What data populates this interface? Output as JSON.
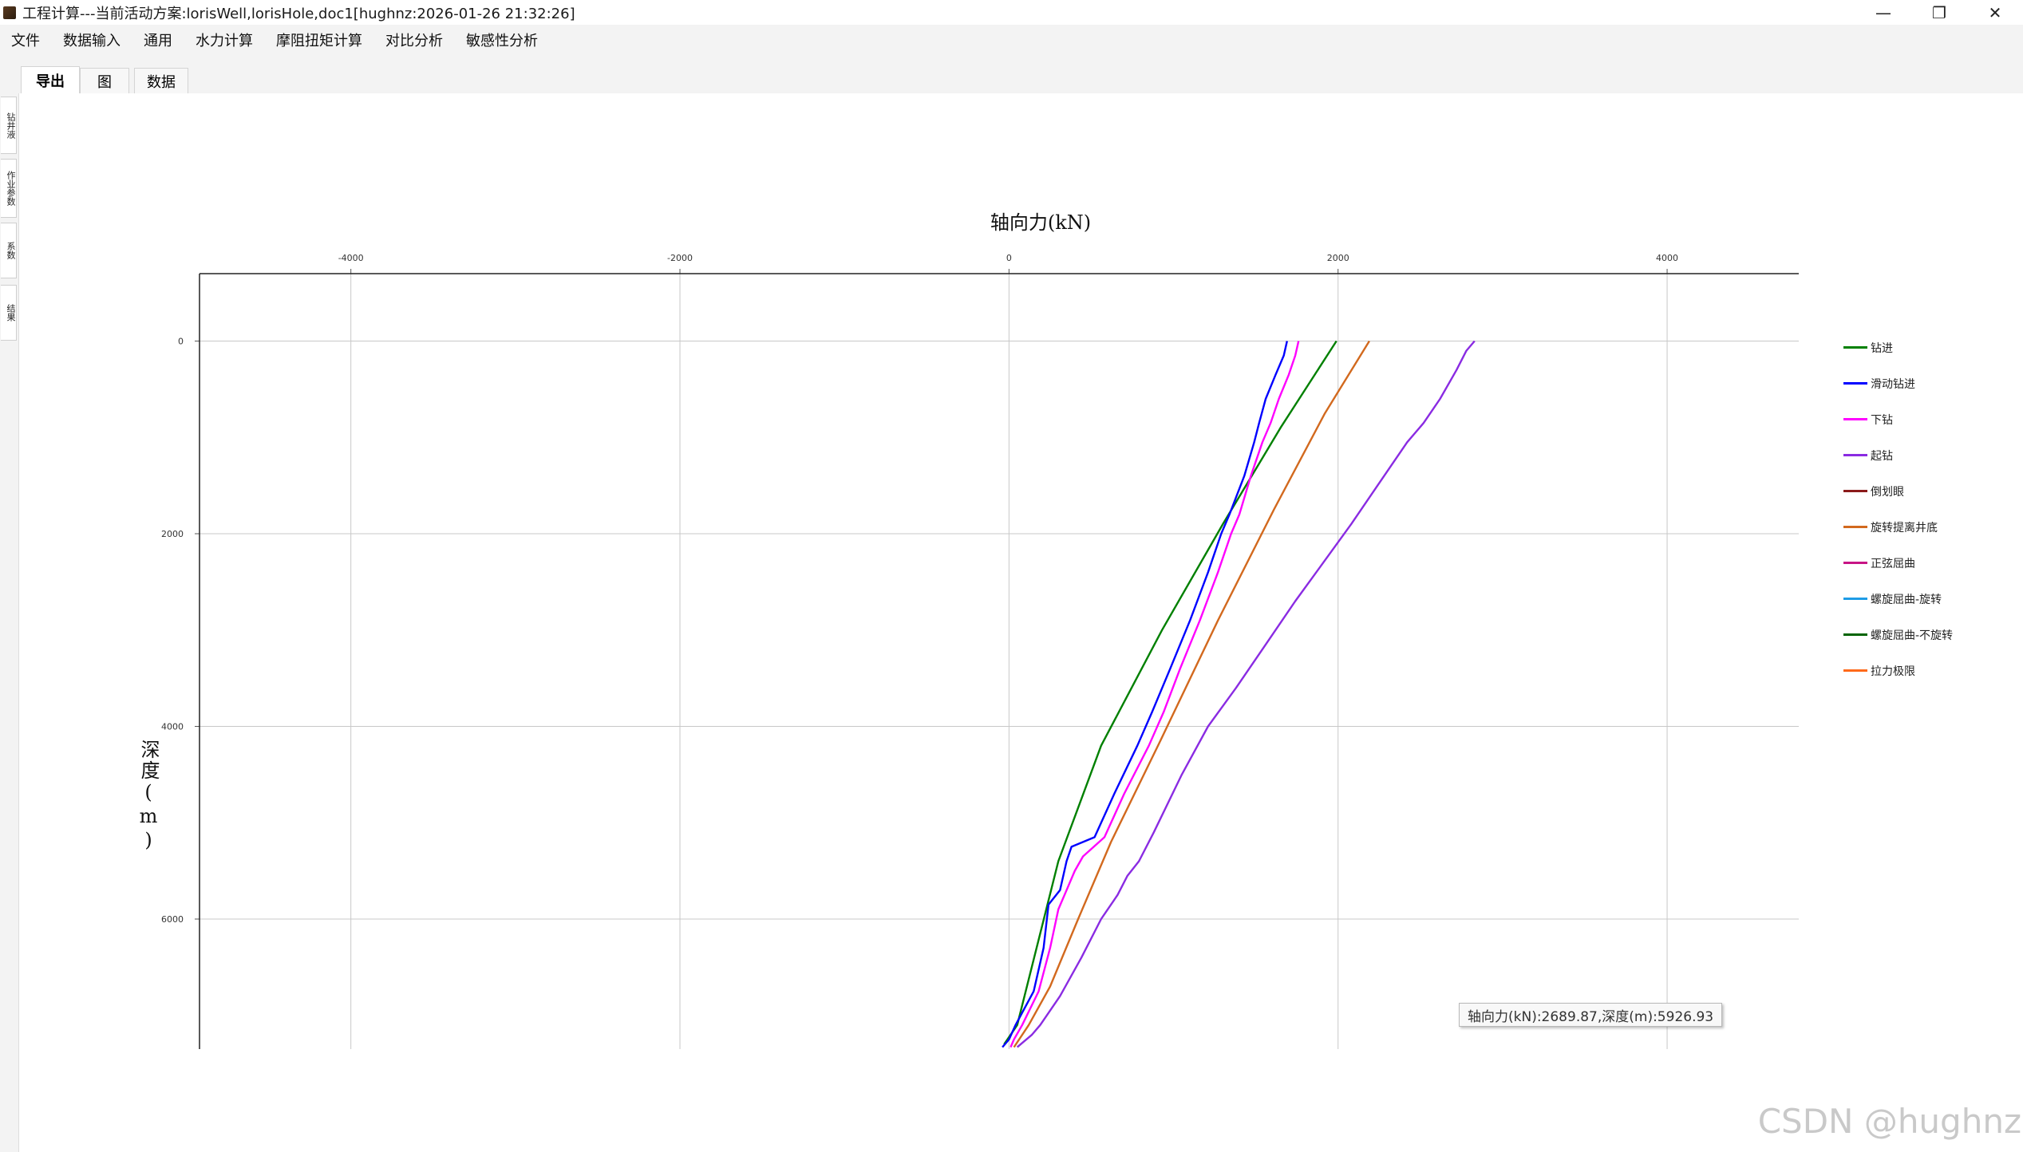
{
  "window": {
    "title": "工程计算---当前活动方案:lorisWell,lorisHole,doc1[hughnz:2026-01-26 21:32:26]",
    "minimize_glyph": "—",
    "maximize_glyph": "❐",
    "close_glyph": "✕"
  },
  "menu": [
    "文件",
    "数据输入",
    "通用",
    "水力计算",
    "摩阻扭矩计算",
    "对比分析",
    "敏感性分析"
  ],
  "tabs": [
    {
      "label": "导出",
      "active": true
    },
    {
      "label": "图",
      "active": false
    },
    {
      "label": "数据",
      "active": false
    }
  ],
  "side_tabs": [
    "钻井液",
    "作业参数",
    "系数",
    "结果"
  ],
  "tooltip": "轴向力(kN):2689.87,深度(m):5926.93",
  "watermark": "CSDN @hughnz",
  "chart_data": {
    "type": "line",
    "title": "轴向力(kN)",
    "xlabel": "轴向力(kN)",
    "ylabel": "深度(m)",
    "x_axis_position": "top",
    "y_axis_inverted": true,
    "xlim": [
      -4920,
      4800
    ],
    "ylim": [
      -700,
      7350
    ],
    "x_ticks": [
      -4000,
      -2000,
      0,
      2000,
      4000
    ],
    "x_tick_labels": [
      "-4000",
      "-2000",
      "0",
      "2000",
      "4000"
    ],
    "y_ticks": [
      0,
      2000,
      4000,
      6000
    ],
    "y_tick_labels": [
      "0",
      "2000",
      "4000",
      "6000"
    ],
    "grid": true,
    "legend_position": "right",
    "series": [
      {
        "name": "钻进",
        "color": "#008000",
        "x": [
          1990,
          1650,
          1300,
          930,
          560,
          300,
          50,
          -30
        ],
        "y": [
          0,
          900,
          1900,
          3000,
          4200,
          5400,
          7100,
          7300
        ]
      },
      {
        "name": "滑动钻进",
        "color": "#0000ff",
        "x": [
          1690,
          1670,
          1620,
          1560,
          1520,
          1490,
          1430,
          1340,
          1290,
          1210,
          1100,
          980,
          870,
          780,
          640,
          520,
          380,
          350,
          310,
          240,
          210,
          150,
          40,
          0,
          -40
        ],
        "y": [
          0,
          150,
          350,
          600,
          850,
          1050,
          1400,
          1800,
          2000,
          2400,
          2900,
          3400,
          3850,
          4200,
          4700,
          5150,
          5250,
          5400,
          5700,
          5850,
          6300,
          6750,
          7100,
          7250,
          7330
        ]
      },
      {
        "name": "下钻",
        "color": "#ff00ff",
        "x": [
          1760,
          1740,
          1700,
          1640,
          1590,
          1540,
          1470,
          1400,
          1350,
          1270,
          1160,
          1040,
          940,
          850,
          700,
          580,
          450,
          400,
          350,
          300,
          250,
          180,
          80,
          30,
          10
        ],
        "y": [
          0,
          150,
          350,
          600,
          850,
          1050,
          1400,
          1800,
          2000,
          2400,
          2900,
          3400,
          3850,
          4200,
          4700,
          5150,
          5350,
          5500,
          5700,
          5900,
          6300,
          6750,
          7100,
          7250,
          7330
        ]
      },
      {
        "name": "起钻",
        "color": "#8a2be2",
        "x": [
          2830,
          2780,
          2720,
          2620,
          2520,
          2420,
          2240,
          2080,
          1910,
          1740,
          1560,
          1380,
          1210,
          1050,
          880,
          790,
          720,
          660,
          560,
          440,
          310,
          190,
          140,
          50
        ],
        "y": [
          0,
          100,
          300,
          600,
          850,
          1050,
          1500,
          1900,
          2300,
          2700,
          3150,
          3600,
          4000,
          4500,
          5100,
          5400,
          5550,
          5750,
          6000,
          6400,
          6800,
          7100,
          7200,
          7330
        ]
      },
      {
        "name": "倒划眼",
        "color": "#8b1a1a",
        "x": [],
        "y": []
      },
      {
        "name": "旋转提离井底",
        "color": "#d2691e",
        "x": [
          2190,
          1920,
          1610,
          1270,
          920,
          620,
          420,
          250,
          120,
          30
        ],
        "y": [
          0,
          750,
          1750,
          2900,
          4150,
          5200,
          6000,
          6700,
          7100,
          7330
        ]
      },
      {
        "name": "正弦屈曲",
        "color": "#c71585",
        "x": [],
        "y": []
      },
      {
        "name": "螺旋屈曲-旋转",
        "color": "#1e9ce6",
        "x": [],
        "y": []
      },
      {
        "name": "螺旋屈曲-不旋转",
        "color": "#006400",
        "x": [],
        "y": []
      },
      {
        "name": "拉力极限",
        "color": "#ff6a1a",
        "x": [],
        "y": []
      }
    ]
  }
}
